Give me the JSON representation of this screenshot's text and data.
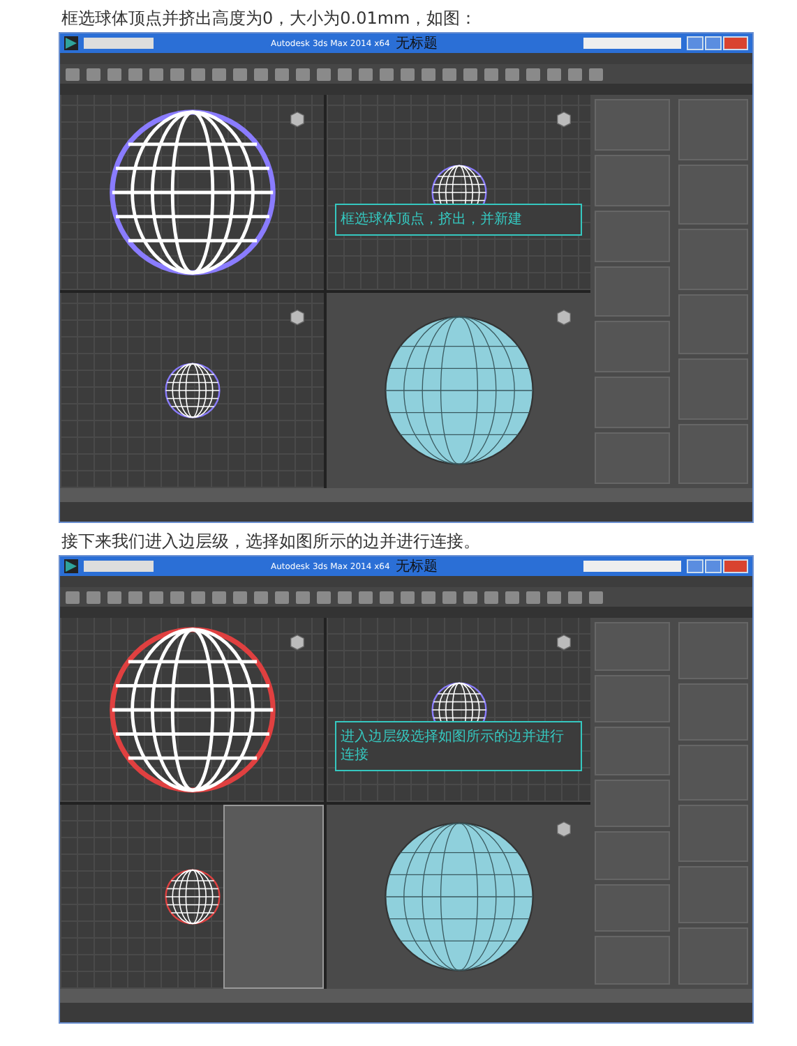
{
  "sections": [
    {
      "caption": "框选球体顶点并挤出高度为0，大小为0.01mm，如图：",
      "screenshot": {
        "window_title": "Autodesk 3ds Max 2014 x64",
        "document_title": "无标题",
        "viewport_note": "框选球体顶点，挤出，并新建",
        "context_menu": false
      }
    },
    {
      "caption": "接下来我们进入边层级，选择如图所示的边并进行连接。",
      "screenshot": {
        "window_title": "Autodesk 3ds Max 2014 x64",
        "document_title": "无标题",
        "viewport_note": "进入边层级选择如图所示的边并进行连接",
        "context_menu": true
      }
    }
  ]
}
